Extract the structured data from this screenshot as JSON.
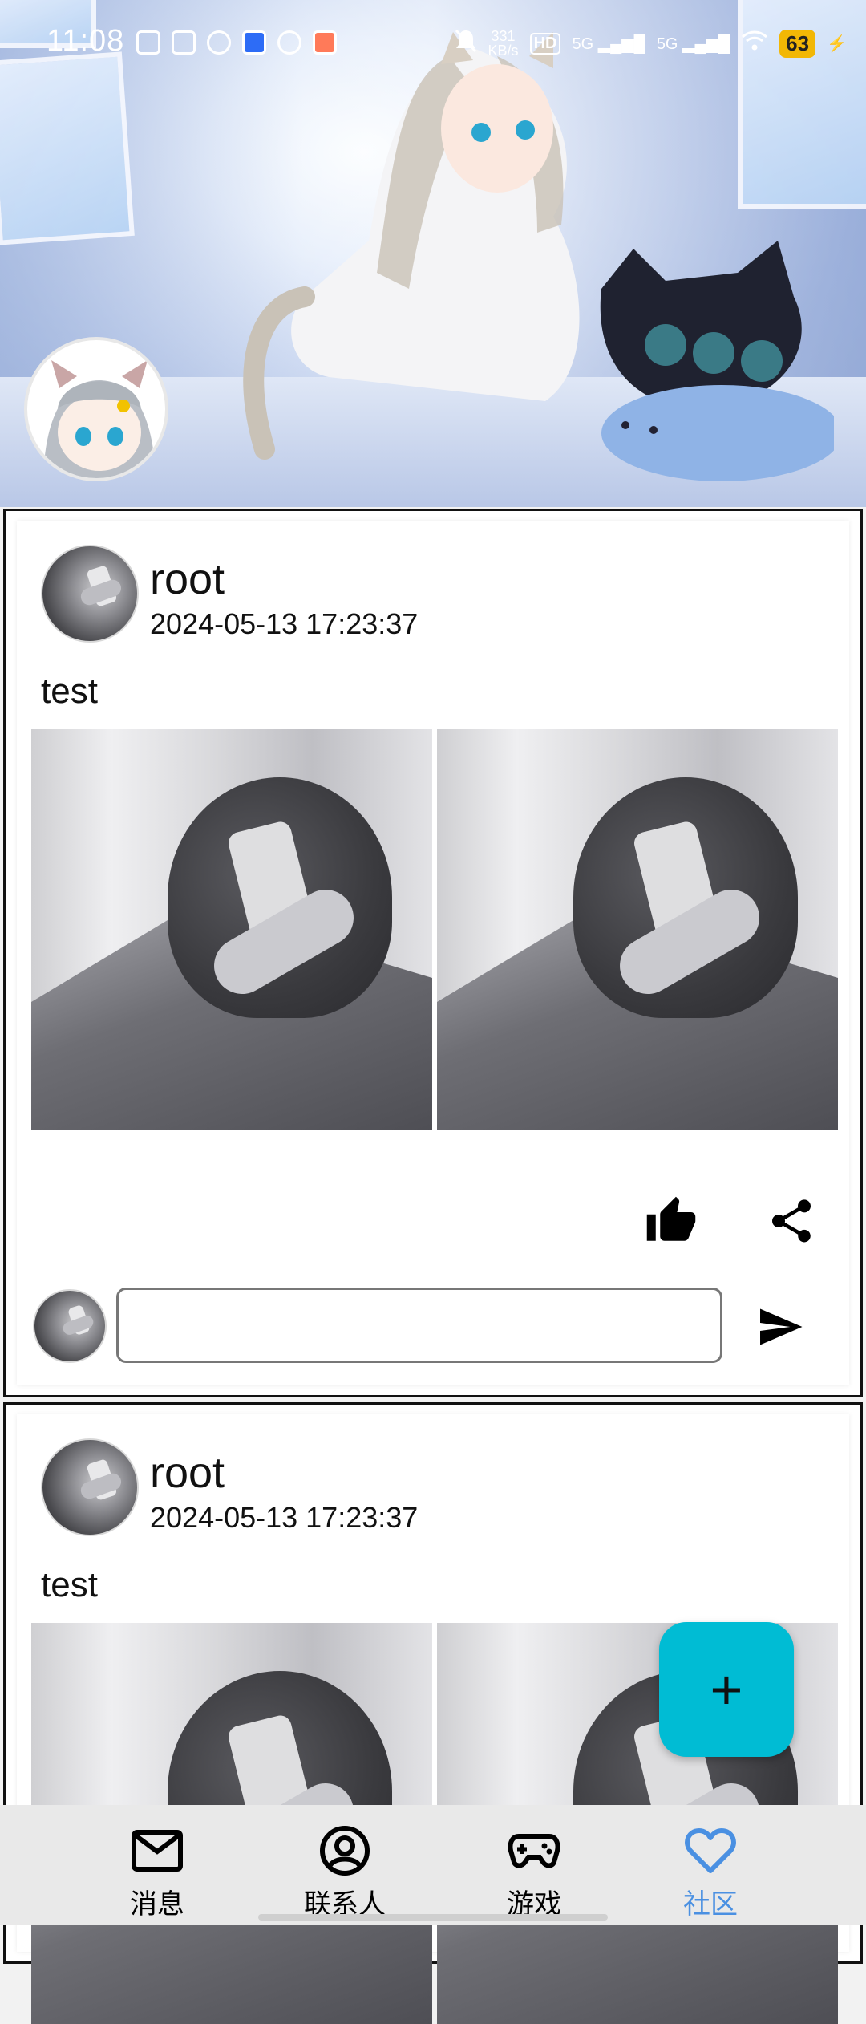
{
  "status_bar": {
    "time": "11:08",
    "net_speed_value": "331",
    "net_speed_unit": "KB/s",
    "hd_label": "HD",
    "signal1_label": "5G",
    "signal2_label": "5G",
    "battery": "63"
  },
  "posts": [
    {
      "username": "root",
      "datetime": "2024-05-13 17:23:37",
      "text": "test",
      "comment_placeholder": ""
    },
    {
      "username": "root",
      "datetime": "2024-05-13 17:23:37",
      "text": "test"
    }
  ],
  "fab": {
    "label": "+"
  },
  "bottom_nav": {
    "items": [
      {
        "label": "消息",
        "icon": "mail-icon"
      },
      {
        "label": "联系人",
        "icon": "account-circle-icon"
      },
      {
        "label": "游戏",
        "icon": "gamepad-icon"
      },
      {
        "label": "社区",
        "icon": "heart-icon"
      }
    ],
    "active_index": 3,
    "active_color": "#4a90e2",
    "inactive_color": "#000000"
  },
  "colors": {
    "fab": "#00bcd4",
    "nav_bg": "#e9e9e9"
  }
}
